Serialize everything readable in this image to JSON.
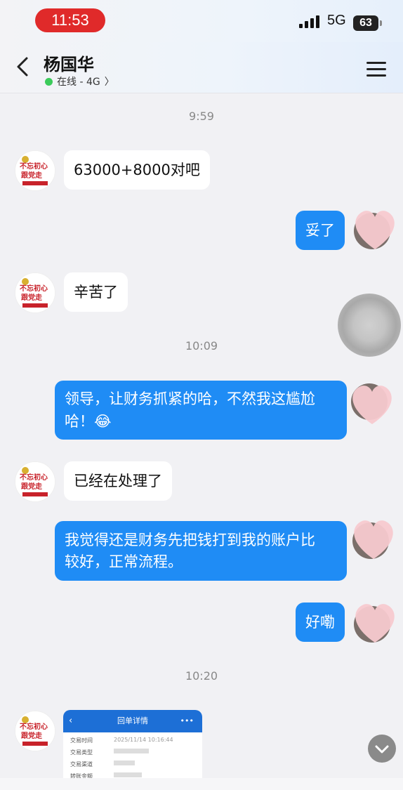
{
  "status": {
    "time": "11:53",
    "network": "5G",
    "battery": "63"
  },
  "header": {
    "title": "杨国华",
    "online": "在线 - 4G",
    "chevron": "〉"
  },
  "messages": {
    "ts1": "9:59",
    "m1": "63000+8000对吧",
    "m2": "妥了",
    "m3": "辛苦了",
    "ts2": "10:09",
    "m4_line1": "领导，让财务抓紧的哈，不然我这尴尬",
    "m4_line2": "哈！😂",
    "m5": "已经在处理了",
    "m6_line1": "我觉得还是财务先把钱打到我的账户比",
    "m6_line2": "较好，正常流程。",
    "m7": "好嘞",
    "ts3": "10:20"
  },
  "receipt": {
    "title": "回单详情",
    "more": "•••",
    "rows": [
      {
        "label": "交易时间",
        "value": "2025/11/14  10:16:44"
      },
      {
        "label": "交易类型",
        "value": ""
      },
      {
        "label": "交易渠道",
        "value": ""
      },
      {
        "label": "转账金额",
        "value": ""
      }
    ]
  },
  "avatar_text": {
    "line1": "不忘初心",
    "line2": "跟党走"
  },
  "colors": {
    "accent": "#1f8cf5",
    "time_pill": "#e02a2a",
    "online": "#3ccb5b"
  }
}
